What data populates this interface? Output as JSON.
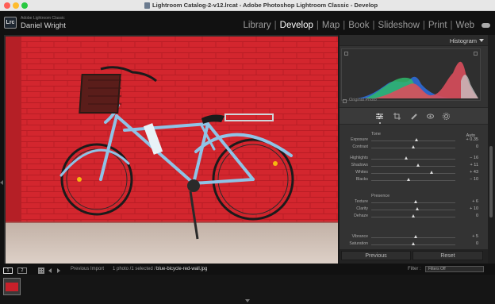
{
  "window": {
    "title": "Lightroom Catalog-2-v12.lrcat - Adobe Photoshop Lightroom Classic - Develop"
  },
  "identity": {
    "app_logo": "Lrc",
    "app_name": "Adobe Lightroom Classic",
    "user": "Daniel Wright"
  },
  "modules": [
    {
      "label": "Library",
      "active": false
    },
    {
      "label": "Develop",
      "active": true
    },
    {
      "label": "Map",
      "active": false
    },
    {
      "label": "Book",
      "active": false
    },
    {
      "label": "Slideshow",
      "active": false
    },
    {
      "label": "Print",
      "active": false
    },
    {
      "label": "Web",
      "active": false
    }
  ],
  "histogram": {
    "title": "Histogram",
    "original_photo_label": "Original Photo"
  },
  "tools": [
    "edit-sliders-icon",
    "crop-icon",
    "healing-brush-icon",
    "red-eye-icon",
    "masking-icon"
  ],
  "tone": {
    "section_label": "Tone",
    "auto_label": "Auto",
    "sliders": [
      {
        "label": "Exposure",
        "value": "+ 0.35",
        "level": 0.54
      },
      {
        "label": "Contrast",
        "value": "0",
        "level": 0.5
      },
      {
        "label": "Highlights",
        "value": "− 16",
        "level": 0.42
      },
      {
        "label": "Shadows",
        "value": "+ 11",
        "level": 0.56
      },
      {
        "label": "Whites",
        "value": "+ 43",
        "level": 0.72
      },
      {
        "label": "Blacks",
        "value": "− 10",
        "level": 0.45
      }
    ]
  },
  "presence": {
    "section_label": "Presence",
    "sliders": [
      {
        "label": "Texture",
        "value": "+ 6",
        "level": 0.53
      },
      {
        "label": "Clarity",
        "value": "+ 10",
        "level": 0.55
      },
      {
        "label": "Dehaze",
        "value": "0",
        "level": 0.5
      },
      {
        "label": "Vibrance",
        "value": "+ 5",
        "level": 0.53
      },
      {
        "label": "Saturation",
        "value": "0",
        "level": 0.5
      }
    ]
  },
  "panel_buttons": {
    "previous": "Previous",
    "reset": "Reset"
  },
  "filmstrip_bar": {
    "monitor_1": "1",
    "monitor_2": "2",
    "previous_import": "Previous Import",
    "count": "1 photo /1 selected /",
    "filename": "blue-bicycle-red-wall.jpg",
    "filter_label": "Filter :",
    "filter_value": "Filters Off"
  },
  "colors": {
    "wall": "#d3262e",
    "bike": "#8fc3e6",
    "ground": "#cfc0b6",
    "accent": "#ffffff"
  }
}
